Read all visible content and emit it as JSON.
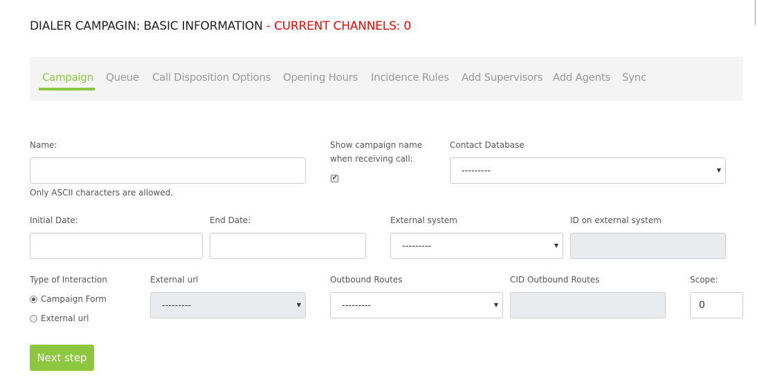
{
  "header": {
    "title": "DIALER CAMPAGIN: BASIC INFORMATION",
    "channels": "- CURRENT CHANNELS: 0"
  },
  "tabs": [
    "Campaign",
    "Queue",
    "Call Disposition Options",
    "Opening Hours",
    "Incidence Rules",
    "Add Supervisors",
    "Add Agents",
    "Sync"
  ],
  "form": {
    "name_label": "Name:",
    "name_value": "",
    "name_help": "Only ASCII characters are allowed.",
    "show_name_label_1": "Show campaign name",
    "show_name_label_2": "when receiving call:",
    "show_name_checked": true,
    "contact_db_label": "Contact Database",
    "contact_db_value": "---------",
    "initial_date_label": "Initial Date:",
    "end_date_label": "End Date:",
    "external_system_label": "External system",
    "external_system_value": "---------",
    "external_id_label": "ID on external system",
    "interaction_label": "Type of Interaction",
    "radio_form": "Campaign Form",
    "radio_url": "External url",
    "external_url_label": "External url",
    "external_url_value": "---------",
    "outbound_label": "Outbound Routes",
    "outbound_value": "---------",
    "cid_label": "CID Outbound Routes",
    "scope_label": "Scope:",
    "scope_value": "0"
  },
  "next_button": "Next step"
}
